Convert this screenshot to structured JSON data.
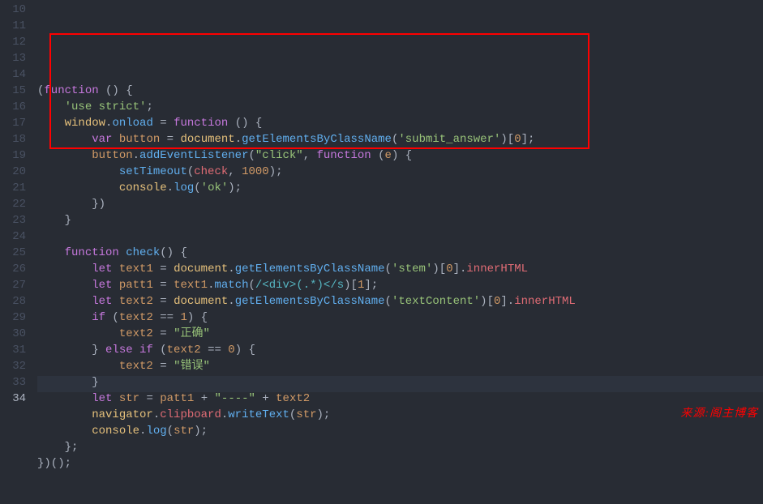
{
  "footer_text": "来源:阁主博客",
  "gutter": {
    "start": 10,
    "end": 34,
    "active": 34
  },
  "lines": [
    {
      "n": 10,
      "segments": []
    },
    {
      "n": 11,
      "segments": [
        {
          "c": "pun",
          "t": "("
        },
        {
          "c": "kw",
          "t": "function"
        },
        {
          "c": "pun",
          "t": " () {"
        }
      ]
    },
    {
      "n": 12,
      "segments": [
        {
          "c": "pun",
          "t": "    "
        },
        {
          "c": "str",
          "t": "'use strict'"
        },
        {
          "c": "pun",
          "t": ";"
        }
      ]
    },
    {
      "n": 13,
      "segments": [
        {
          "c": "pun",
          "t": "    "
        },
        {
          "c": "obj",
          "t": "window"
        },
        {
          "c": "pun",
          "t": "."
        },
        {
          "c": "fn",
          "t": "onload"
        },
        {
          "c": "pun",
          "t": " = "
        },
        {
          "c": "kw",
          "t": "function"
        },
        {
          "c": "pun",
          "t": " () {"
        }
      ]
    },
    {
      "n": 14,
      "segments": [
        {
          "c": "pun",
          "t": "        "
        },
        {
          "c": "kw",
          "t": "var"
        },
        {
          "c": "pun",
          "t": " "
        },
        {
          "c": "varLocal",
          "t": "button"
        },
        {
          "c": "pun",
          "t": " = "
        },
        {
          "c": "obj",
          "t": "document"
        },
        {
          "c": "pun",
          "t": "."
        },
        {
          "c": "fn",
          "t": "getElementsByClassName"
        },
        {
          "c": "pun",
          "t": "("
        },
        {
          "c": "str",
          "t": "'submit_answer'"
        },
        {
          "c": "pun",
          "t": ")["
        },
        {
          "c": "num",
          "t": "0"
        },
        {
          "c": "pun",
          "t": "];"
        }
      ]
    },
    {
      "n": 15,
      "segments": [
        {
          "c": "pun",
          "t": "        "
        },
        {
          "c": "varLocal",
          "t": "button"
        },
        {
          "c": "pun",
          "t": "."
        },
        {
          "c": "fn",
          "t": "addEventListener"
        },
        {
          "c": "pun",
          "t": "("
        },
        {
          "c": "str",
          "t": "\"click\""
        },
        {
          "c": "pun",
          "t": ", "
        },
        {
          "c": "kw",
          "t": "function"
        },
        {
          "c": "pun",
          "t": " ("
        },
        {
          "c": "varLocal",
          "t": "e"
        },
        {
          "c": "pun",
          "t": ") {"
        }
      ]
    },
    {
      "n": 16,
      "segments": [
        {
          "c": "pun",
          "t": "            "
        },
        {
          "c": "fn",
          "t": "setTimeout"
        },
        {
          "c": "pun",
          "t": "("
        },
        {
          "c": "var",
          "t": "check"
        },
        {
          "c": "pun",
          "t": ", "
        },
        {
          "c": "num",
          "t": "1000"
        },
        {
          "c": "pun",
          "t": ");"
        }
      ]
    },
    {
      "n": 17,
      "segments": [
        {
          "c": "pun",
          "t": "            "
        },
        {
          "c": "obj",
          "t": "console"
        },
        {
          "c": "pun",
          "t": "."
        },
        {
          "c": "fn",
          "t": "log"
        },
        {
          "c": "pun",
          "t": "("
        },
        {
          "c": "str",
          "t": "'ok'"
        },
        {
          "c": "pun",
          "t": ");"
        }
      ]
    },
    {
      "n": 18,
      "segments": [
        {
          "c": "pun",
          "t": "        })"
        }
      ]
    },
    {
      "n": 19,
      "segments": [
        {
          "c": "pun",
          "t": "    }"
        }
      ]
    },
    {
      "n": 20,
      "segments": []
    },
    {
      "n": 21,
      "segments": [
        {
          "c": "pun",
          "t": "    "
        },
        {
          "c": "kw",
          "t": "function"
        },
        {
          "c": "pun",
          "t": " "
        },
        {
          "c": "fn",
          "t": "check"
        },
        {
          "c": "pun",
          "t": "() {"
        }
      ]
    },
    {
      "n": 22,
      "segments": [
        {
          "c": "pun",
          "t": "        "
        },
        {
          "c": "kw",
          "t": "let"
        },
        {
          "c": "pun",
          "t": " "
        },
        {
          "c": "varLocal",
          "t": "text1"
        },
        {
          "c": "pun",
          "t": " = "
        },
        {
          "c": "obj",
          "t": "document"
        },
        {
          "c": "pun",
          "t": "."
        },
        {
          "c": "fn",
          "t": "getElementsByClassName"
        },
        {
          "c": "pun",
          "t": "("
        },
        {
          "c": "str",
          "t": "'stem'"
        },
        {
          "c": "pun",
          "t": ")["
        },
        {
          "c": "num",
          "t": "0"
        },
        {
          "c": "pun",
          "t": "]."
        },
        {
          "c": "var",
          "t": "innerHTML"
        }
      ]
    },
    {
      "n": 23,
      "segments": [
        {
          "c": "pun",
          "t": "        "
        },
        {
          "c": "kw",
          "t": "let"
        },
        {
          "c": "pun",
          "t": " "
        },
        {
          "c": "varLocal",
          "t": "patt1"
        },
        {
          "c": "pun",
          "t": " = "
        },
        {
          "c": "varLocal",
          "t": "text1"
        },
        {
          "c": "pun",
          "t": "."
        },
        {
          "c": "fn",
          "t": "match"
        },
        {
          "c": "pun",
          "t": "("
        },
        {
          "c": "regex",
          "t": "/<div>(.*)</s"
        },
        {
          "c": "pun",
          "t": ")["
        },
        {
          "c": "num",
          "t": "1"
        },
        {
          "c": "pun",
          "t": "];"
        }
      ]
    },
    {
      "n": 24,
      "segments": [
        {
          "c": "pun",
          "t": "        "
        },
        {
          "c": "kw",
          "t": "let"
        },
        {
          "c": "pun",
          "t": " "
        },
        {
          "c": "varLocal",
          "t": "text2"
        },
        {
          "c": "pun",
          "t": " = "
        },
        {
          "c": "obj",
          "t": "document"
        },
        {
          "c": "pun",
          "t": "."
        },
        {
          "c": "fn",
          "t": "getElementsByClassName"
        },
        {
          "c": "pun",
          "t": "("
        },
        {
          "c": "str",
          "t": "'textContent'"
        },
        {
          "c": "pun",
          "t": ")["
        },
        {
          "c": "num",
          "t": "0"
        },
        {
          "c": "pun",
          "t": "]."
        },
        {
          "c": "var",
          "t": "innerHTML"
        }
      ]
    },
    {
      "n": 25,
      "segments": [
        {
          "c": "pun",
          "t": "        "
        },
        {
          "c": "kw",
          "t": "if"
        },
        {
          "c": "pun",
          "t": " ("
        },
        {
          "c": "varLocal",
          "t": "text2"
        },
        {
          "c": "pun",
          "t": " == "
        },
        {
          "c": "num",
          "t": "1"
        },
        {
          "c": "pun",
          "t": ") {"
        }
      ]
    },
    {
      "n": 26,
      "segments": [
        {
          "c": "pun",
          "t": "            "
        },
        {
          "c": "varLocal",
          "t": "text2"
        },
        {
          "c": "pun",
          "t": " = "
        },
        {
          "c": "str",
          "t": "\"正确\""
        }
      ]
    },
    {
      "n": 27,
      "segments": [
        {
          "c": "pun",
          "t": "        } "
        },
        {
          "c": "kw",
          "t": "else"
        },
        {
          "c": "pun",
          "t": " "
        },
        {
          "c": "kw",
          "t": "if"
        },
        {
          "c": "pun",
          "t": " ("
        },
        {
          "c": "varLocal",
          "t": "text2"
        },
        {
          "c": "pun",
          "t": " == "
        },
        {
          "c": "num",
          "t": "0"
        },
        {
          "c": "pun",
          "t": ") {"
        }
      ]
    },
    {
      "n": 28,
      "segments": [
        {
          "c": "pun",
          "t": "            "
        },
        {
          "c": "varLocal",
          "t": "text2"
        },
        {
          "c": "pun",
          "t": " = "
        },
        {
          "c": "str",
          "t": "\"错误\""
        }
      ]
    },
    {
      "n": 29,
      "segments": [
        {
          "c": "pun",
          "t": "        }"
        }
      ]
    },
    {
      "n": 30,
      "segments": [
        {
          "c": "pun",
          "t": "        "
        },
        {
          "c": "kw",
          "t": "let"
        },
        {
          "c": "pun",
          "t": " "
        },
        {
          "c": "varLocal",
          "t": "str"
        },
        {
          "c": "pun",
          "t": " = "
        },
        {
          "c": "varLocal",
          "t": "patt1"
        },
        {
          "c": "pun",
          "t": " + "
        },
        {
          "c": "str",
          "t": "\"----\""
        },
        {
          "c": "pun",
          "t": " + "
        },
        {
          "c": "varLocal",
          "t": "text2"
        }
      ]
    },
    {
      "n": 31,
      "segments": [
        {
          "c": "pun",
          "t": "        "
        },
        {
          "c": "obj",
          "t": "navigator"
        },
        {
          "c": "pun",
          "t": "."
        },
        {
          "c": "var",
          "t": "clipboard"
        },
        {
          "c": "pun",
          "t": "."
        },
        {
          "c": "fn",
          "t": "writeText"
        },
        {
          "c": "pun",
          "t": "("
        },
        {
          "c": "varLocal",
          "t": "str"
        },
        {
          "c": "pun",
          "t": ");"
        }
      ]
    },
    {
      "n": 32,
      "segments": [
        {
          "c": "pun",
          "t": "        "
        },
        {
          "c": "obj",
          "t": "console"
        },
        {
          "c": "pun",
          "t": "."
        },
        {
          "c": "fn",
          "t": "log"
        },
        {
          "c": "pun",
          "t": "("
        },
        {
          "c": "varLocal",
          "t": "str"
        },
        {
          "c": "pun",
          "t": ");"
        }
      ]
    },
    {
      "n": 33,
      "segments": [
        {
          "c": "pun",
          "t": "    };"
        }
      ]
    },
    {
      "n": 34,
      "segments": [
        {
          "c": "pun",
          "t": "})();"
        }
      ]
    }
  ]
}
